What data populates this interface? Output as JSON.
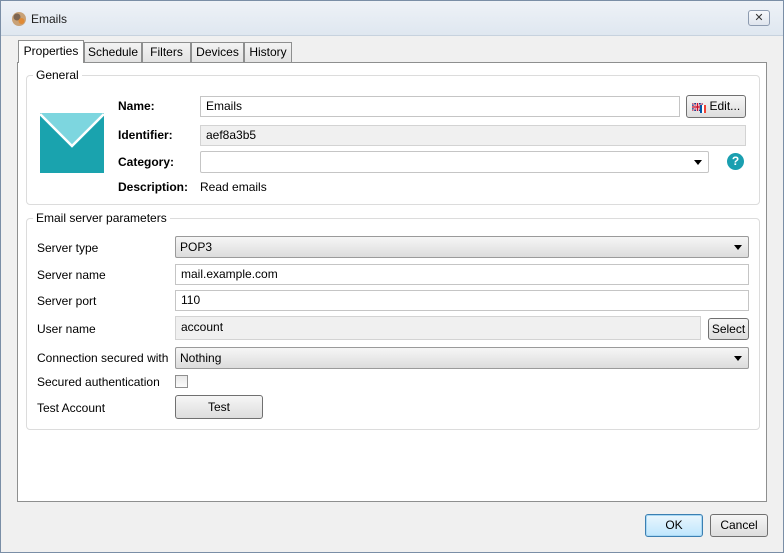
{
  "window": {
    "title": "Emails",
    "close_label": "✕"
  },
  "tabs": [
    {
      "label": "Properties",
      "active": true
    },
    {
      "label": "Schedule"
    },
    {
      "label": "Filters"
    },
    {
      "label": "Devices"
    },
    {
      "label": "History"
    }
  ],
  "general": {
    "legend": "General",
    "name_label": "Name:",
    "name_value": "Emails",
    "edit_label": "Edit...",
    "identifier_label": "Identifier:",
    "identifier_value": "aef8a3b5",
    "category_label": "Category:",
    "category_value": "",
    "help_label": "?",
    "description_label": "Description:",
    "description_value": "Read emails"
  },
  "server": {
    "legend": "Email server parameters",
    "type_label": "Server type",
    "type_value": "POP3",
    "name_label": "Server name",
    "name_value": "mail.example.com",
    "port_label": "Server port",
    "port_value": "110",
    "user_label": "User name",
    "user_value": "account",
    "select_label": "Select",
    "secured_label": "Connection secured with",
    "secured_value": "Nothing",
    "auth_label": "Secured authentication",
    "auth_checked": false,
    "test_account_label": "Test Account",
    "test_label": "Test"
  },
  "footer": {
    "ok_label": "OK",
    "cancel_label": "Cancel"
  },
  "colors": {
    "accent": "#1a9fb0",
    "envelope": "#1aa3ae"
  }
}
